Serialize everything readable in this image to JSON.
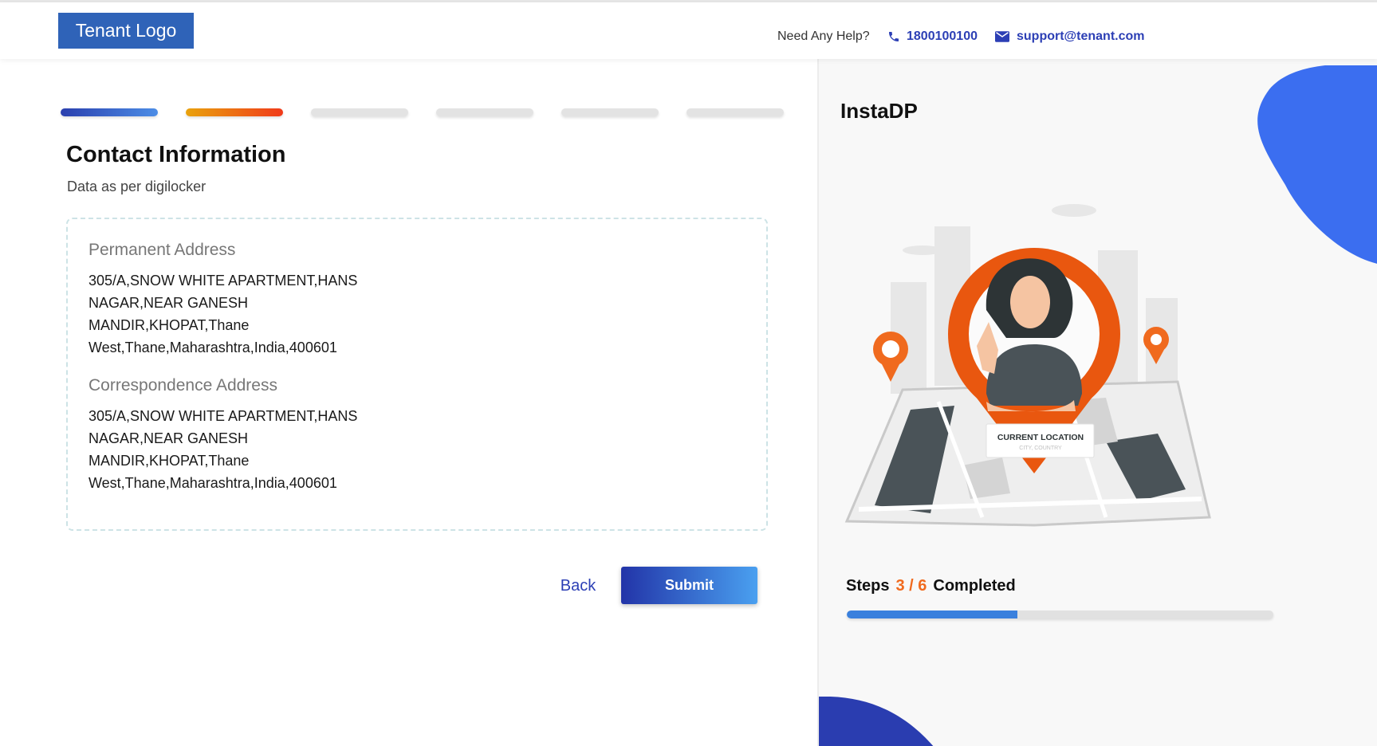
{
  "header": {
    "logo_text": "Tenant Logo",
    "help_label": "Need Any Help?",
    "phone": "1800100100",
    "email": "support@tenant.com"
  },
  "stepper": {
    "total": 6,
    "current": 2
  },
  "form": {
    "title": "Contact Information",
    "subtitle": "Data as per digilocker",
    "permanent_label": "Permanent Address",
    "permanent_value": "305/A,SNOW WHITE APARTMENT,HANS NAGAR,NEAR GANESH MANDIR,KHOPAT,Thane West,Thane,Maharashtra,India,400601",
    "correspondence_label": "Correspondence Address",
    "correspondence_value": "305/A,SNOW WHITE APARTMENT,HANS NAGAR,NEAR GANESH MANDIR,KHOPAT,Thane West,Thane,Maharashtra,India,400601",
    "back_label": "Back",
    "submit_label": "Submit"
  },
  "sidebar": {
    "brand": "InstaDP",
    "illustration_label": "CURRENT LOCATION",
    "illustration_sub": "CITY, COUNTRY",
    "steps_prefix": "Steps",
    "steps_count": "3 / 6",
    "steps_suffix": "Completed",
    "progress_fraction": 0.4,
    "accent_color": "#f06a1e",
    "progress_color": "#3a80dd"
  },
  "colors": {
    "primary": "#2c3fb5",
    "logo_bg": "#2f63b8"
  },
  "icons": {
    "phone": "phone-icon",
    "mail": "mail-icon"
  }
}
